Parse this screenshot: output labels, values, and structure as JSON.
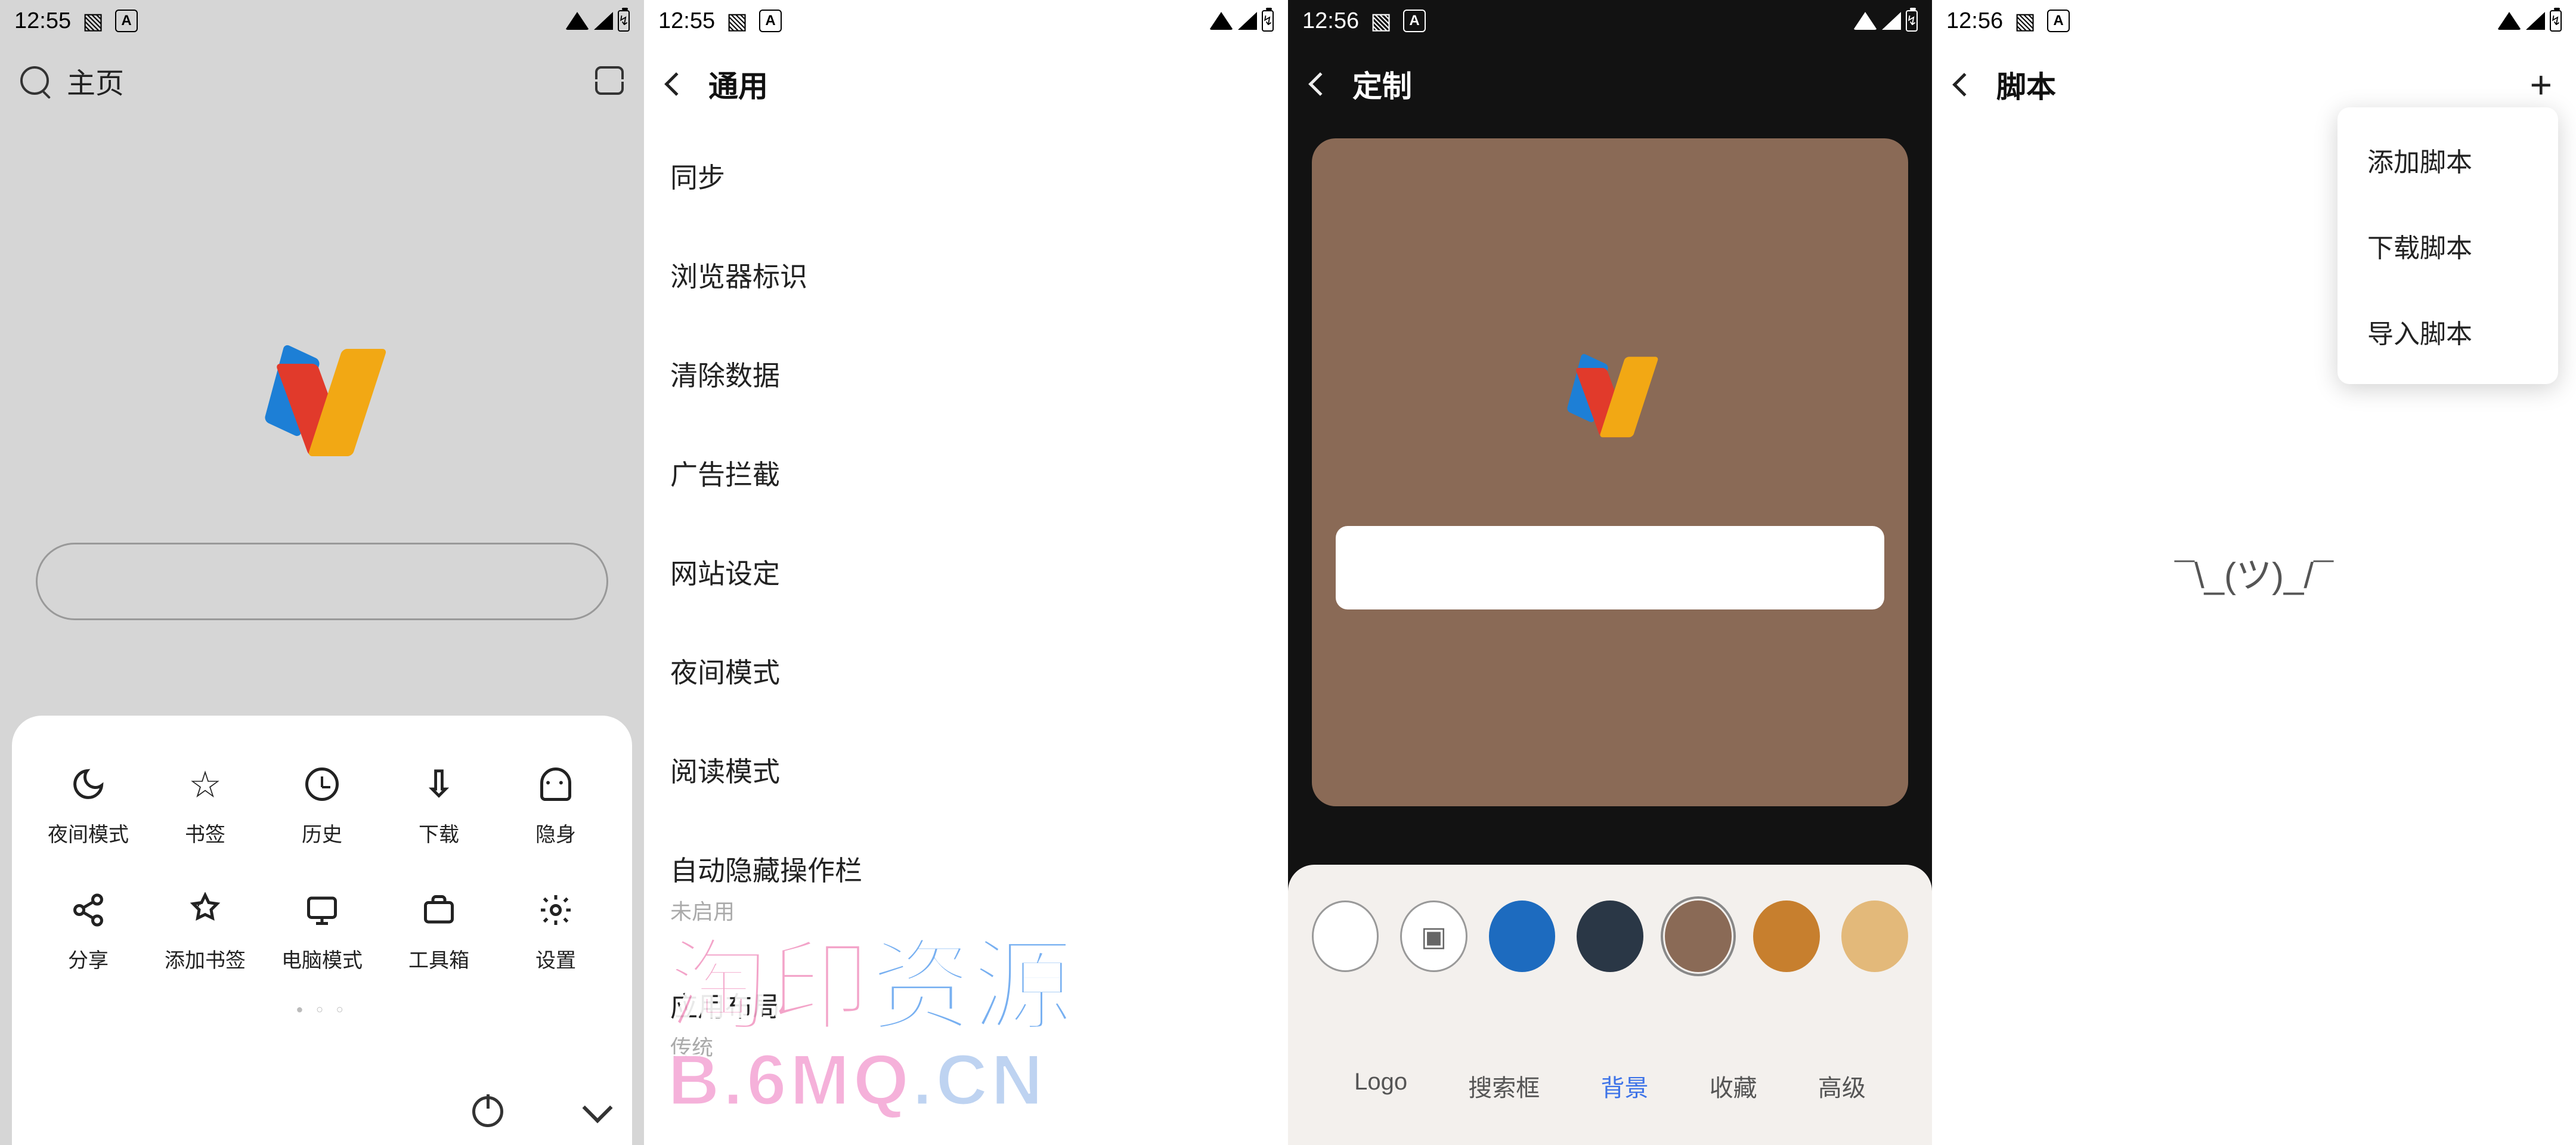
{
  "status": {
    "t1": "12:55",
    "t2": "12:56",
    "a": "A"
  },
  "p1": {
    "home": "主页",
    "grid": [
      {
        "l": "夜间模式"
      },
      {
        "l": "书签"
      },
      {
        "l": "历史"
      },
      {
        "l": "下载"
      },
      {
        "l": "隐身"
      },
      {
        "l": "分享"
      },
      {
        "l": "添加书签"
      },
      {
        "l": "电脑模式"
      },
      {
        "l": "工具箱"
      },
      {
        "l": "设置"
      }
    ]
  },
  "p2": {
    "title": "通用",
    "items": [
      "同步",
      "浏览器标识",
      "清除数据",
      "广告拦截",
      "网站设定",
      "夜间模式",
      "阅读模式"
    ],
    "auto_hide": "自动隐藏操作栏",
    "auto_hide_sub": "未启用",
    "layout": "应用布局",
    "layout_sub": "传统",
    "wm1": "淘印资源",
    "wm2a": "B.6MQ",
    "wm2b": ".CN"
  },
  "p3": {
    "title": "定制",
    "colors": [
      "#ffffff",
      "image",
      "#1d6bbf",
      "#2a3746",
      "#8a6a56",
      "#c77f2e",
      "#e3b97a"
    ],
    "selected": 4,
    "tabs": [
      "Logo",
      "搜索框",
      "背景",
      "收藏",
      "高级"
    ],
    "active_tab": 2
  },
  "p4": {
    "title": "脚本",
    "shrug": "¯\\_(ツ)_/¯",
    "menu": [
      "添加脚本",
      "下载脚本",
      "导入脚本"
    ]
  }
}
